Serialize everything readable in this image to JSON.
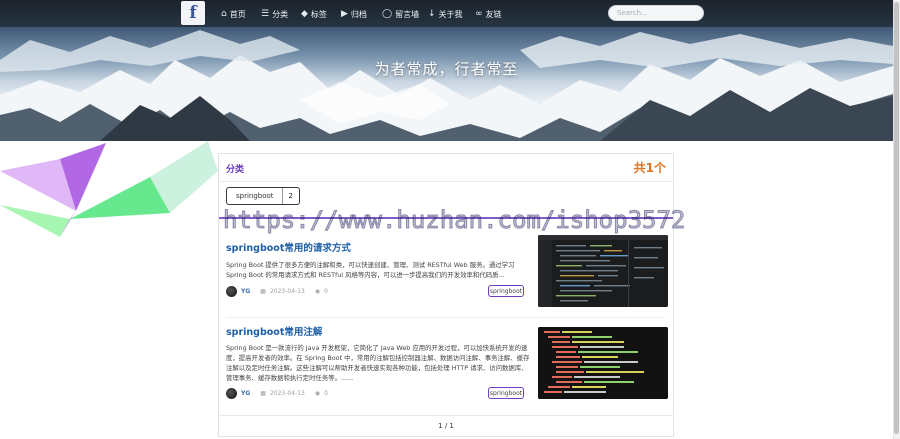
{
  "nav": {
    "logo_letter": "f",
    "items": [
      {
        "label": "首页",
        "icon": "home-icon"
      },
      {
        "label": "分类",
        "icon": "list-icon"
      },
      {
        "label": "标签",
        "icon": "tag-icon"
      },
      {
        "label": "归档",
        "icon": "archive-icon"
      },
      {
        "label": "留言墙",
        "icon": "comment-icon"
      },
      {
        "label": "关于我",
        "icon": "user-icon"
      },
      {
        "label": "友链",
        "icon": "link-icon"
      }
    ],
    "search_placeholder": "Search..."
  },
  "hero": {
    "title": "为者常成，行者常至"
  },
  "panel": {
    "title": "分类",
    "count_label": "共1个",
    "tag": {
      "name": "springboot",
      "count": "2"
    },
    "watermark": "https://www.huzhan.com/ishop3572"
  },
  "posts": [
    {
      "title": "springboot常用的请求方式",
      "excerpt": "Spring Boot 提供了很多方便的注解和类，可以快速创建、管理、测试 RESTful Web 服务。通过学习 Spring Boot 的常用请求方式和 RESTful 风格等内容，可以进一步提高我们的开发效率和代码质...",
      "author": "YG",
      "date": "2023-04-13",
      "views": "0",
      "tag": "springboot"
    },
    {
      "title": "springboot常用注解",
      "excerpt": "Spring Boot 是一款流行的 Java 开发框架，它简化了 Java Web 应用的开发过程，可以加快系统开发的速度，提高开发者的效率。在 Spring Boot 中，常用的注解包括控制器注解、数据访问注解、事务注解、缓存注解以及定时任务注解。这些注解可以帮助开发者快速实现各种功能，包括处理 HTTP 请求、访问数据库、管理事务、缓存数据和执行定时任务等。......",
      "author": "YG",
      "date": "2023-04-13",
      "views": "0",
      "tag": "springboot"
    }
  ],
  "pagination": {
    "label": "1 / 1"
  },
  "colors": {
    "accent": "#6a3fc0",
    "count": "#e0731f",
    "link": "#1f5fa8"
  }
}
